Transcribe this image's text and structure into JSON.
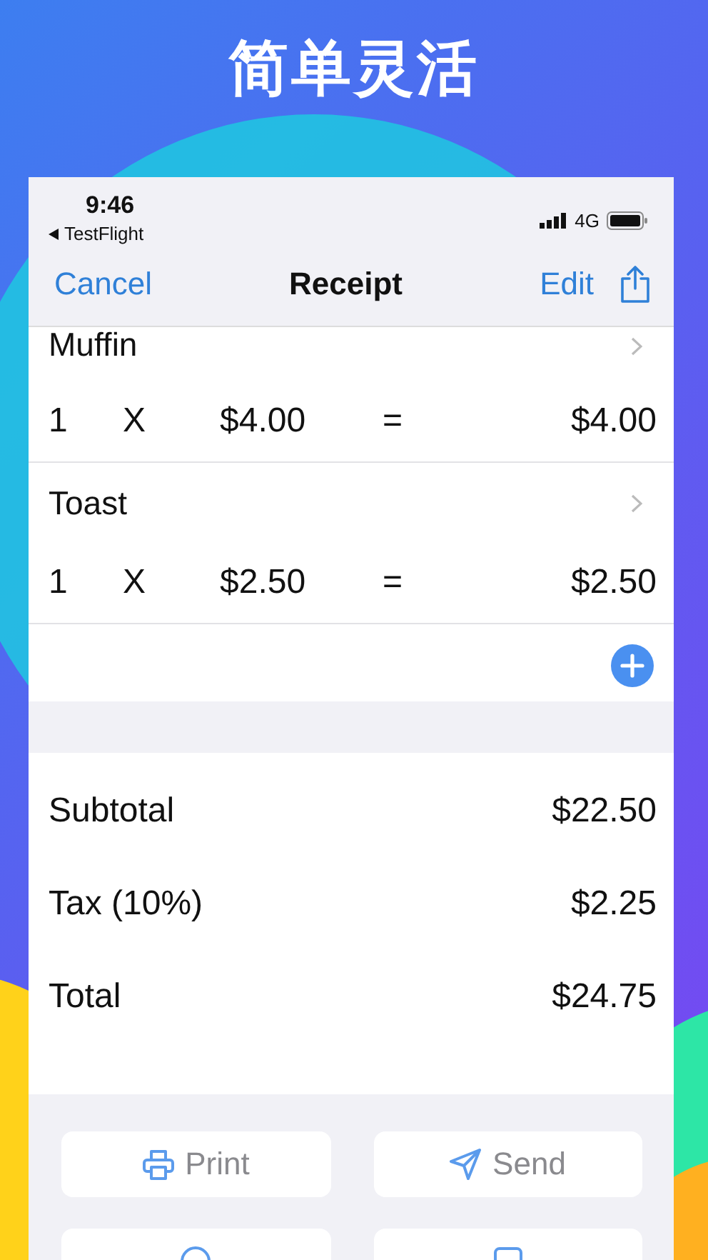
{
  "header": {
    "title": "简单灵活"
  },
  "status_bar": {
    "time": "9:46",
    "back_link": "TestFlight",
    "network": "4G"
  },
  "nav": {
    "cancel": "Cancel",
    "title": "Receipt",
    "edit": "Edit"
  },
  "items": [
    {
      "name": "Muffin",
      "qty": "1",
      "times": "X",
      "price": "$4.00",
      "equals": "=",
      "total": "$4.00"
    },
    {
      "name": "Toast",
      "qty": "1",
      "times": "X",
      "price": "$2.50",
      "equals": "=",
      "total": "$2.50"
    }
  ],
  "totals": [
    {
      "label": "Subtotal",
      "value": "$22.50"
    },
    {
      "label": "Tax (10%)",
      "value": "$2.25"
    },
    {
      "label": "Total",
      "value": "$24.75"
    }
  ],
  "actions": [
    {
      "label": "Print",
      "kind": "print"
    },
    {
      "label": "Send",
      "kind": "send"
    },
    {
      "kind": "preview"
    },
    {
      "kind": "text"
    }
  ]
}
